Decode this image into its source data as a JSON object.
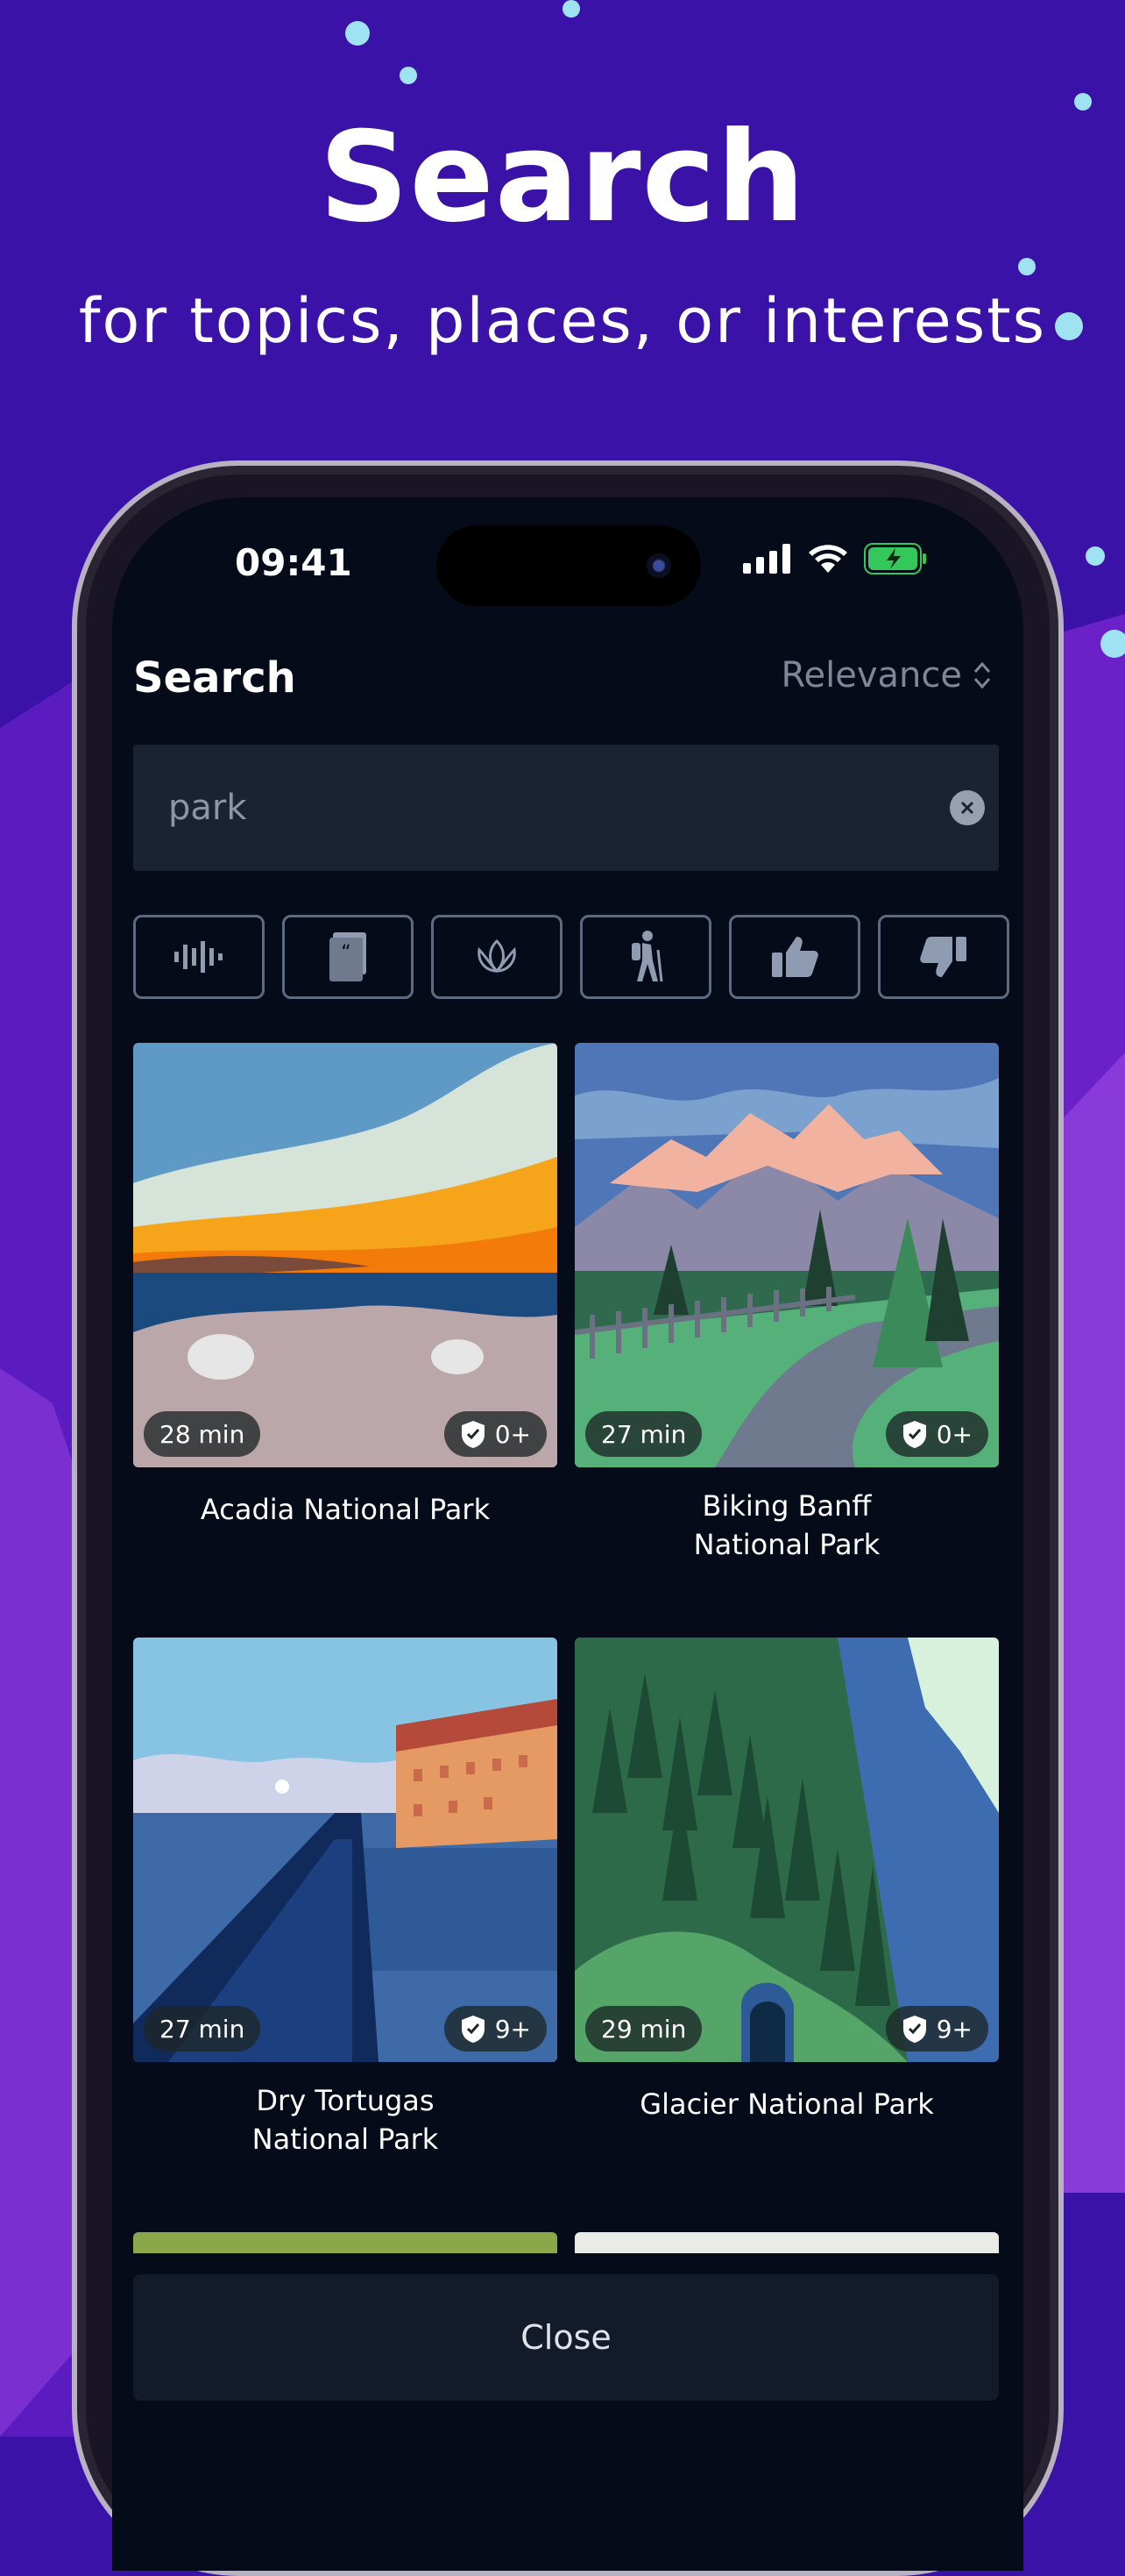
{
  "promo": {
    "title": "Search",
    "subtitle": "for topics, places, or interests"
  },
  "status_bar": {
    "time": "09:41"
  },
  "header": {
    "title": "Search",
    "sort_label": "Relevance"
  },
  "search": {
    "value": "park"
  },
  "filters": [
    {
      "icon": "soundscape-icon"
    },
    {
      "icon": "quote-book-icon"
    },
    {
      "icon": "lotus-icon"
    },
    {
      "icon": "hiker-icon"
    },
    {
      "icon": "thumbs-up-icon"
    },
    {
      "icon": "thumbs-down-icon"
    }
  ],
  "results": [
    {
      "title": "Acadia National Park",
      "duration": "28 min",
      "rating": "0+"
    },
    {
      "title": "Biking Banff National Park",
      "duration": "27 min",
      "rating": "0+"
    },
    {
      "title": "Dry Tortugas National Park",
      "duration": "27 min",
      "rating": "9+"
    },
    {
      "title": "Glacier National Park",
      "duration": "29 min",
      "rating": "9+"
    }
  ],
  "footer": {
    "close_label": "Close"
  },
  "colors": {
    "background": "#3a12a8",
    "screen": "#050b19",
    "accent_battery": "#34c759"
  }
}
